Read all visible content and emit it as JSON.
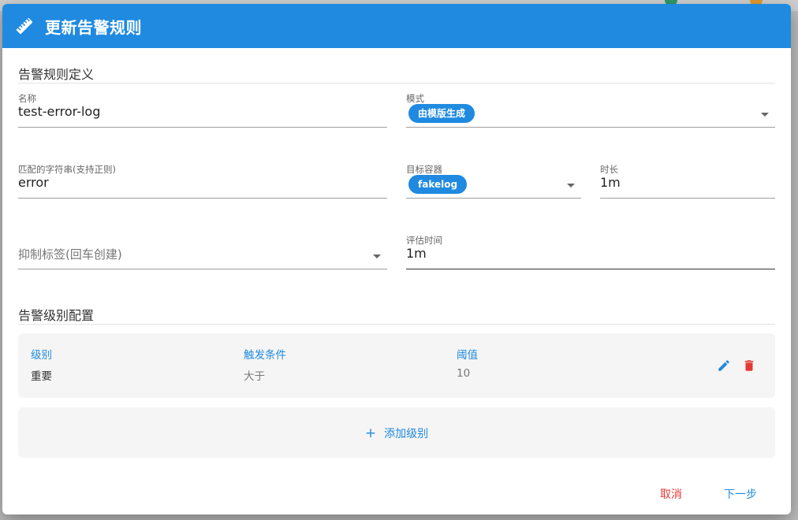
{
  "dialog": {
    "title": "更新告警规则",
    "header_icon": "ruler-icon"
  },
  "sections": {
    "definition": "告警规则定义",
    "levels": "告警级别配置"
  },
  "form": {
    "name": {
      "label": "名称",
      "value": "test-error-log"
    },
    "mode": {
      "label": "模式",
      "value": "由模版生成"
    },
    "match": {
      "label": "匹配的字符串(支持正则)",
      "value": "error"
    },
    "container": {
      "label": "目标容器",
      "value": "fakelog"
    },
    "duration": {
      "label": "时长",
      "value": "1m"
    },
    "suppress": {
      "placeholder": "抑制标签(回车创建)"
    },
    "eval": {
      "label": "评估时间",
      "value": "1m"
    }
  },
  "levels_table": {
    "headers": [
      "级别",
      "触发条件",
      "阈值"
    ],
    "rows": [
      {
        "level": "重要",
        "condition": "大于",
        "threshold": "10"
      }
    ],
    "add_label": "添加级别"
  },
  "actions": {
    "cancel": "取消",
    "next": "下一步"
  },
  "colors": {
    "primary": "#1f8ae0",
    "danger": "#e53935"
  }
}
